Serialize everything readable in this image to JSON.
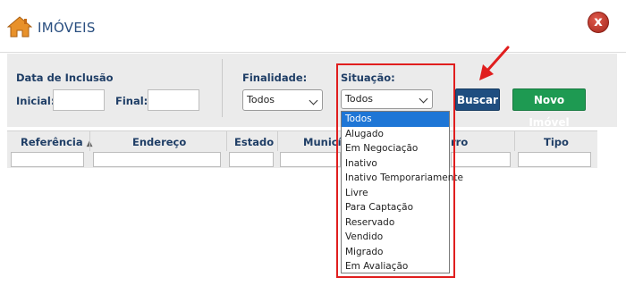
{
  "header": {
    "title": "IMÓVEIS",
    "close_label": "x",
    "home_icon": "home-icon"
  },
  "filters": {
    "date_group_label": "Data de Inclusão",
    "initial_label": "Inicial:",
    "final_label": "Final:",
    "initial_value": "",
    "final_value": "",
    "finalidade_label": "Finalidade:",
    "finalidade_value": "Todos",
    "situacao_label": "Situação:",
    "situacao_value": "Todos",
    "situacao_options": [
      "Todos",
      "Alugado",
      "Em Negociação",
      "Inativo",
      "Inativo Temporariamente",
      "Livre",
      "Para Captação",
      "Reservado",
      "Vendido",
      "Migrado",
      "Em Avaliação"
    ],
    "situacao_selected": "Todos"
  },
  "buttons": {
    "buscar": "Buscar",
    "novo_imovel": "Novo Imóvel"
  },
  "grid": {
    "columns": [
      "Referência",
      "Endereço",
      "Estado",
      "Municí",
      "rro",
      "Tipo"
    ],
    "sort_icon": "sort-icon"
  },
  "annotations": {
    "highlight_color": "#e01e1e",
    "arrow_color": "#e01e1e"
  },
  "colors": {
    "label_blue": "#1f3e66",
    "title_blue": "#2a4f80",
    "buscar_bg": "#1f4e80",
    "novo_bg": "#1e9a52",
    "selected_option": "#1e76d6"
  }
}
